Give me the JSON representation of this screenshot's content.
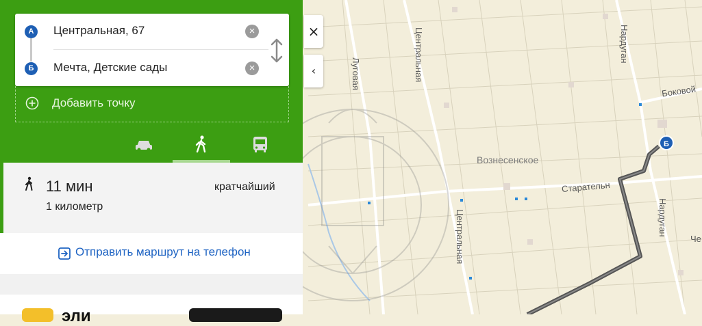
{
  "route": {
    "point_a": {
      "badge": "А",
      "text": "Центральная, 67"
    },
    "point_b": {
      "badge": "Б",
      "text": "Мечта, Детские сады"
    },
    "add_point": "Добавить точку"
  },
  "modes": [
    {
      "name": "car-icon",
      "selected": false
    },
    {
      "name": "walk-icon",
      "selected": true
    },
    {
      "name": "bus-icon",
      "selected": false
    }
  ],
  "result": {
    "time": "11 мин",
    "distance": "1 километр",
    "tag": "кратчайший"
  },
  "send_route": "Отправить маршрут на телефон",
  "promo": {
    "text": "эли"
  },
  "side_buttons": {
    "close": "×",
    "collapse": "‹"
  },
  "map": {
    "streets": [
      "Центральная",
      "Луговая",
      "Нардуган",
      "Боковой",
      "Старательн",
      "Центральная",
      "Нардуган",
      "Че"
    ],
    "village": "Вознесенское",
    "pin_b": "Б"
  },
  "colors": {
    "green": "#3c9e12",
    "accent_blue": "#1e5fb4",
    "link": "#1f64c3",
    "map_bg": "#f3eedb"
  }
}
